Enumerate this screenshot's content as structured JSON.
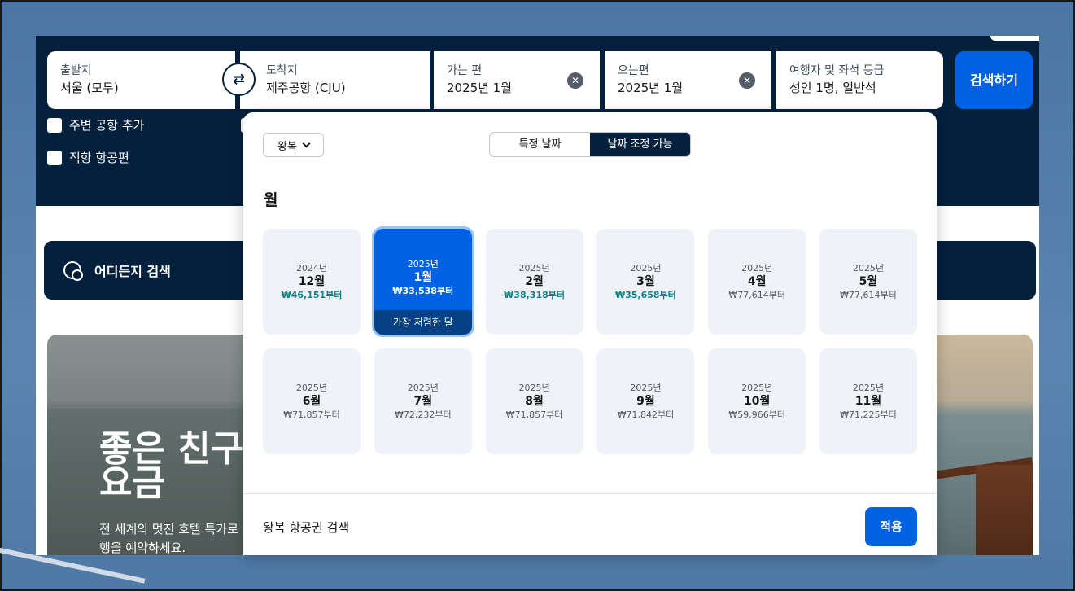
{
  "search": {
    "origin": {
      "label": "출발지",
      "value": "서울 (모두)"
    },
    "destination": {
      "label": "도착지",
      "value": "제주공항 (CJU)"
    },
    "depart": {
      "label": "가는 편",
      "value": "2025년 1월"
    },
    "return": {
      "label": "오는편",
      "value": "2025년 1월"
    },
    "travellers": {
      "label": "여행자 및 좌석 등급",
      "value": "성인 1명, 일반석"
    },
    "search_button": "검색하기",
    "swap_icon": "⇄",
    "clear_icon": "✕",
    "nearby_airports": "주변 공항 추가",
    "direct_flights": "직항 항공편"
  },
  "explore": {
    "label": "어디든지 검색",
    "icon": "globe-search-icon"
  },
  "hero": {
    "headline_1": "좋은 친구",
    "headline_2": "요금",
    "sub_1": "전 세계의 멋진 호텔 특가로",
    "sub_2": "행을 예약하세요."
  },
  "picker": {
    "trip_type": "왕복",
    "mode_specific": "특정 날짜",
    "mode_flexible": "날짜 조정 가능",
    "section_title": "월",
    "months": [
      {
        "year": "2024년",
        "month": "12월",
        "price": "₩46,151부터",
        "cheap": true
      },
      {
        "year": "2025년",
        "month": "1월",
        "price": "₩33,538부터",
        "cheap": true,
        "selected": true,
        "tag": "가장 저렴한 달"
      },
      {
        "year": "2025년",
        "month": "2월",
        "price": "₩38,318부터",
        "cheap": true
      },
      {
        "year": "2025년",
        "month": "3월",
        "price": "₩35,658부터",
        "cheap": true
      },
      {
        "year": "2025년",
        "month": "4월",
        "price": "₩77,614부터",
        "cheap": false
      },
      {
        "year": "2025년",
        "month": "5월",
        "price": "₩77,614부터",
        "cheap": false
      },
      {
        "year": "2025년",
        "month": "6월",
        "price": "₩71,857부터",
        "cheap": false
      },
      {
        "year": "2025년",
        "month": "7월",
        "price": "₩72,232부터",
        "cheap": false
      },
      {
        "year": "2025년",
        "month": "8월",
        "price": "₩71,857부터",
        "cheap": false
      },
      {
        "year": "2025년",
        "month": "9월",
        "price": "₩71,842부터",
        "cheap": false
      },
      {
        "year": "2025년",
        "month": "10월",
        "price": "₩59,966부터",
        "cheap": false
      },
      {
        "year": "2025년",
        "month": "11월",
        "price": "₩71,225부터",
        "cheap": false
      }
    ],
    "footer_text": "왕복 항공권 검색",
    "apply_button": "적용"
  },
  "colors": {
    "navy": "#05203c",
    "primary": "#0062e3",
    "cheap": "#0c838a"
  }
}
